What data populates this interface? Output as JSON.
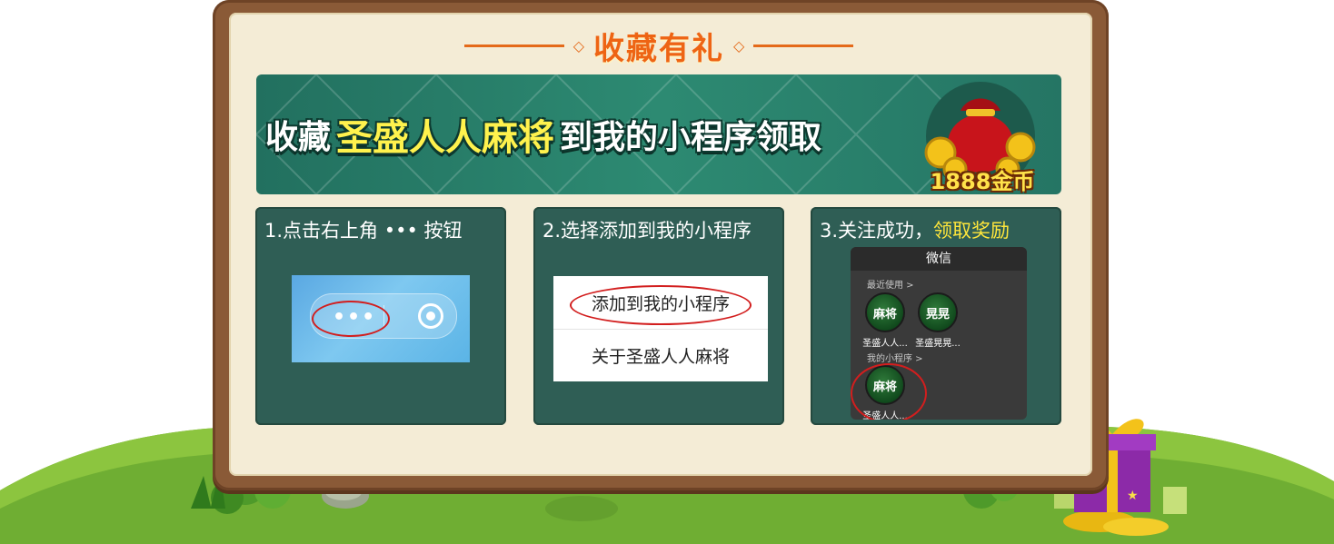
{
  "title": "收藏有礼",
  "banner": {
    "pre": "收藏",
    "name": "圣盛人人麻将",
    "post": "到我的小程序领取",
    "reward": "1888金币"
  },
  "steps": [
    {
      "title": "1.点击右上角 •••   按钮",
      "dots": "•••"
    },
    {
      "title": "2.选择添加到我的小程序",
      "menu": [
        "添加到我的小程序",
        "关于圣盛人人麻将"
      ]
    },
    {
      "title_main": "3.关注成功，",
      "title_highlight": "领取奖励",
      "phone": {
        "header": "微信",
        "recent_label": "最近使用 >",
        "mine_label": "我的小程序 >",
        "recent_apps": [
          {
            "icon_text": "麻将",
            "label": "圣盛人人..."
          },
          {
            "icon_text": "晃晃",
            "label": "圣盛晃晃..."
          }
        ],
        "mine_apps": [
          {
            "icon_text": "麻将",
            "label": "圣盛人人..."
          }
        ]
      }
    }
  ],
  "colors": {
    "frame": "#8a5a37",
    "board": "#f4ecd6",
    "title": "#ee6414",
    "banner": "#2d8a72",
    "card": "#2f5e55",
    "highlight": "#ffe63b",
    "circle_mark": "#d21e1e"
  },
  "icons": [
    "money-bag-icon",
    "gold-coins-icon",
    "gift-box-icon",
    "target-icon",
    "more-dots-icon"
  ]
}
